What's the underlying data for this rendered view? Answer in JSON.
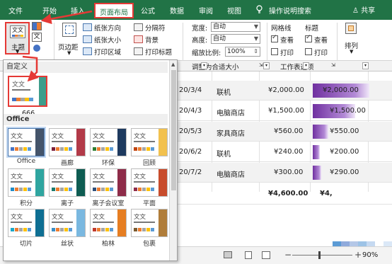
{
  "menu": {
    "file": "文件",
    "home": "开始",
    "insert": "插入",
    "page_layout": "页面布局",
    "formulas": "公式",
    "data": "数据",
    "review": "审阅",
    "view": "视图",
    "tell_me_icon": "lightbulb-icon",
    "tell_me": "操作说明搜索",
    "share": "共享"
  },
  "ribbon": {
    "themes": "主题",
    "margins": "页边距",
    "orientation": "纸张方向",
    "size": "纸张大小",
    "print_area": "打印区域",
    "breaks": "分隔符",
    "background": "背景",
    "print_titles": "打印标题",
    "width_label": "宽度:",
    "width_value": "自动",
    "height_label": "高度:",
    "height_value": "自动",
    "scale_label": "缩放比例:",
    "scale_value": "100%",
    "scale_group": "调整为合适大小",
    "gridlines": "网格线",
    "headings": "标题",
    "view_label": "查看",
    "print_label": "打印",
    "sheet_options_group": "工作表选项",
    "arrange": "排列"
  },
  "theme_panel": {
    "custom_header": "自定义",
    "custom_theme_name": "666",
    "office_header": "Office",
    "tile_title": "文文",
    "themes": [
      {
        "name": "Office",
        "accent": "#4472c4",
        "stripe": "#44546a",
        "selected": true
      },
      {
        "name": "画廊",
        "accent": "#7b1f3a",
        "stripe": "#b23a48",
        "selected": false
      },
      {
        "name": "环保",
        "accent": "#2e7d32",
        "stripe": "#1e3a5f",
        "selected": false
      },
      {
        "name": "回顾",
        "accent": "#c1440e",
        "stripe": "#f2c14e",
        "selected": false
      },
      {
        "name": "积分",
        "accent": "#1f8bc7",
        "stripe": "#2fa5a0",
        "selected": false
      },
      {
        "name": "离子",
        "accent": "#1b7a6e",
        "stripe": "#0e5c52",
        "selected": false
      },
      {
        "name": "离子会议室",
        "accent": "#2f4f7a",
        "stripe": "#8e2c49",
        "selected": false
      },
      {
        "name": "平面",
        "accent": "#8e2c49",
        "stripe": "#c84c2c",
        "selected": false
      },
      {
        "name": "切片",
        "accent": "#1aa7c9",
        "stripe": "#0e6f93",
        "selected": false
      },
      {
        "name": "丝状",
        "accent": "#3b8dc4",
        "stripe": "#7ab8e0",
        "selected": false
      },
      {
        "name": "柏林",
        "accent": "#c0392b",
        "stripe": "#e67e22",
        "selected": false
      },
      {
        "name": "包裹",
        "accent": "#7a5a2f",
        "stripe": "#b07d3a",
        "selected": false
      }
    ]
  },
  "sheet": {
    "rows": [
      {
        "date": "20/3/4",
        "category": "联机",
        "amount": "¥2,000.00",
        "bar_value": "¥2,000.00",
        "bar_fraction": 1.0
      },
      {
        "date": "20/4/3",
        "category": "电脑商店",
        "amount": "¥1,500.00",
        "bar_value": "¥1,500.00",
        "bar_fraction": 0.75
      },
      {
        "date": "20/5/3",
        "category": "家具商店",
        "amount": "¥560.00",
        "bar_value": "¥550.00",
        "bar_fraction": 0.28
      },
      {
        "date": "20/6/2",
        "category": "联机",
        "amount": "¥240.00",
        "bar_value": "¥200.00",
        "bar_fraction": 0.12
      },
      {
        "date": "20/7/2",
        "category": "电脑商店",
        "amount": "¥300.00",
        "bar_value": "¥290.00",
        "bar_fraction": 0.15
      }
    ],
    "total": "¥4,600.00",
    "total_partial": "¥4,"
  },
  "status": {
    "zoom": "90%",
    "zoom_fraction": 0.45
  }
}
